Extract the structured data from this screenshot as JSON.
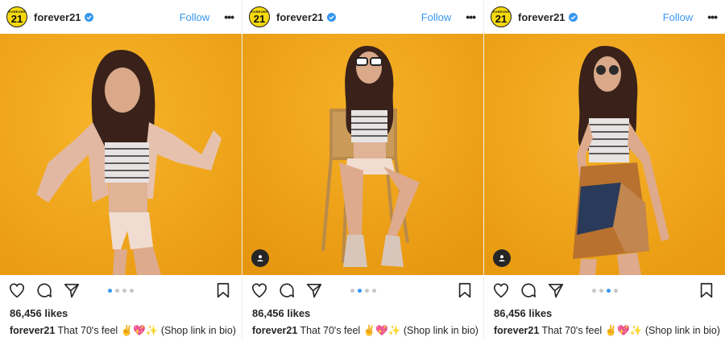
{
  "posts": [
    {
      "username": "forever21",
      "avatar": {
        "top_text": "FOREVER",
        "big_text": "21"
      },
      "follow_label": "Follow",
      "more_label": "•••",
      "likes": "86,456 likes",
      "caption_user": "forever21",
      "caption_text": "That 70's feel ✌️💖✨ (Shop link in bio)",
      "carousel_active": 0,
      "carousel_count": 4,
      "show_user_tag": false
    },
    {
      "username": "forever21",
      "avatar": {
        "top_text": "FOREVER",
        "big_text": "21"
      },
      "follow_label": "Follow",
      "more_label": "•••",
      "likes": "86,456 likes",
      "caption_user": "forever21",
      "caption_text": "That 70's feel ✌️💖✨ (Shop link in bio)",
      "carousel_active": 1,
      "carousel_count": 4,
      "show_user_tag": true
    },
    {
      "username": "forever21",
      "avatar": {
        "top_text": "FOREVER",
        "big_text": "21"
      },
      "follow_label": "Follow",
      "more_label": "•••",
      "likes": "86,456 likes",
      "caption_user": "forever21",
      "caption_text": "That 70's feel ✌️💖✨ (Shop link in bio)",
      "carousel_active": 2,
      "carousel_count": 4,
      "show_user_tag": true
    }
  ],
  "colors": {
    "accent": "#3897f0",
    "photo_bg": "#f2a91a",
    "brand_yellow": "#f5d90f"
  },
  "icons": [
    "heart-icon",
    "comment-icon",
    "share-icon",
    "bookmark-icon",
    "verified-icon",
    "user-tag-icon"
  ]
}
